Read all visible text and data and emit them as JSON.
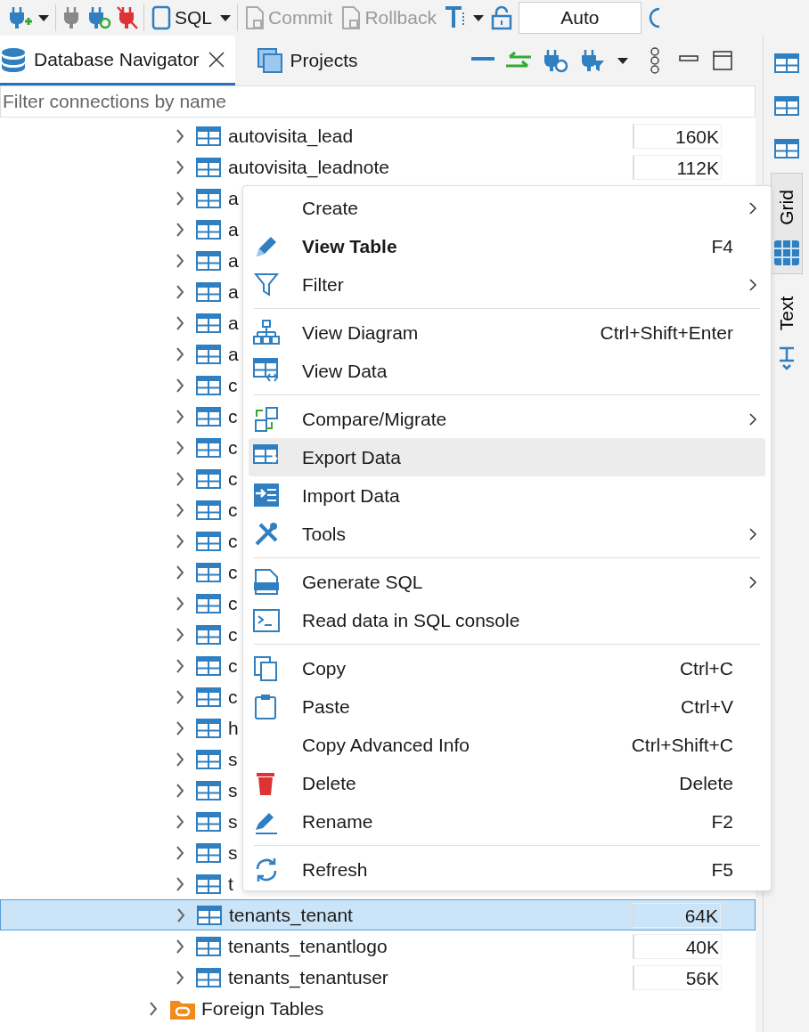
{
  "toolbar": {
    "sql": "SQL",
    "commit": {
      "label": "Commit",
      "disabled": true
    },
    "rollback": {
      "label": "Rollback",
      "disabled": true
    },
    "mode": "Auto"
  },
  "tabs": [
    {
      "label": "Database Navigator",
      "selected": true,
      "closable": true
    },
    {
      "label": "Projects",
      "selected": false,
      "closable": false
    }
  ],
  "filter": {
    "placeholder": "Filter connections by name"
  },
  "tables": [
    {
      "name": "autovisita_lead",
      "size": "160K",
      "selected": false
    },
    {
      "name": "autovisita_leadnote",
      "size": "112K",
      "selected": false
    },
    {
      "name": "a",
      "selected": false
    },
    {
      "name": "a",
      "selected": false
    },
    {
      "name": "a",
      "selected": false
    },
    {
      "name": "a",
      "selected": false
    },
    {
      "name": "a",
      "selected": false
    },
    {
      "name": "a",
      "selected": false
    },
    {
      "name": "c",
      "selected": false
    },
    {
      "name": "c",
      "selected": false
    },
    {
      "name": "c",
      "selected": false
    },
    {
      "name": "c",
      "selected": false
    },
    {
      "name": "c",
      "selected": false
    },
    {
      "name": "c",
      "selected": false
    },
    {
      "name": "c",
      "selected": false
    },
    {
      "name": "c",
      "selected": false
    },
    {
      "name": "c",
      "selected": false
    },
    {
      "name": "c",
      "selected": false
    },
    {
      "name": "c",
      "selected": false
    },
    {
      "name": "h",
      "selected": false
    },
    {
      "name": "s",
      "selected": false
    },
    {
      "name": "s",
      "selected": false
    },
    {
      "name": "s",
      "selected": false
    },
    {
      "name": "s",
      "selected": false
    },
    {
      "name": "t",
      "selected": false
    },
    {
      "name": "tenants_tenant",
      "size": "64K",
      "selected": true
    },
    {
      "name": "tenants_tenantlogo",
      "size": "40K",
      "selected": false
    },
    {
      "name": "tenants_tenantuser",
      "size": "56K",
      "selected": false
    }
  ],
  "folders": [
    {
      "name": "Foreign Tables",
      "expanded": false
    }
  ],
  "menu": [
    [
      {
        "label": "Create",
        "submenu": true,
        "default": false,
        "highlighted": false
      },
      {
        "label": "View Table",
        "shortcut": "F4",
        "submenu": false,
        "default": true,
        "highlighted": false
      },
      {
        "label": "Filter",
        "submenu": true,
        "default": false,
        "highlighted": false
      }
    ],
    [
      {
        "label": "View Diagram",
        "shortcut": "Ctrl+Shift+Enter",
        "submenu": false,
        "default": false,
        "highlighted": false
      },
      {
        "label": "View Data",
        "submenu": false,
        "default": false,
        "highlighted": false
      }
    ],
    [
      {
        "label": "Compare/Migrate",
        "submenu": true,
        "default": false,
        "highlighted": false
      },
      {
        "label": "Export Data",
        "submenu": false,
        "default": false,
        "highlighted": true
      },
      {
        "label": "Import Data",
        "submenu": false,
        "default": false,
        "highlighted": false
      },
      {
        "label": "Tools",
        "submenu": true,
        "default": false,
        "highlighted": false
      }
    ],
    [
      {
        "label": "Generate SQL",
        "submenu": true,
        "default": false,
        "highlighted": false
      },
      {
        "label": "Read data in SQL console",
        "submenu": false,
        "default": false,
        "highlighted": false
      }
    ],
    [
      {
        "label": "Copy",
        "shortcut": "Ctrl+C",
        "submenu": false,
        "default": false,
        "highlighted": false
      },
      {
        "label": "Paste",
        "shortcut": "Ctrl+V",
        "submenu": false,
        "default": false,
        "highlighted": false
      },
      {
        "label": "Copy Advanced Info",
        "shortcut": "Ctrl+Shift+C",
        "submenu": false,
        "default": false,
        "highlighted": false
      },
      {
        "label": "Delete",
        "shortcut": "Delete",
        "submenu": false,
        "default": false,
        "highlighted": false
      },
      {
        "label": "Rename",
        "shortcut": "F2",
        "submenu": false,
        "default": false,
        "highlighted": false
      }
    ],
    [
      {
        "label": "Refresh",
        "shortcut": "F5",
        "submenu": false,
        "default": false,
        "highlighted": false
      }
    ]
  ],
  "side_tabs": [
    {
      "label": "Grid",
      "selected": true
    },
    {
      "label": "Text",
      "selected": false
    }
  ]
}
